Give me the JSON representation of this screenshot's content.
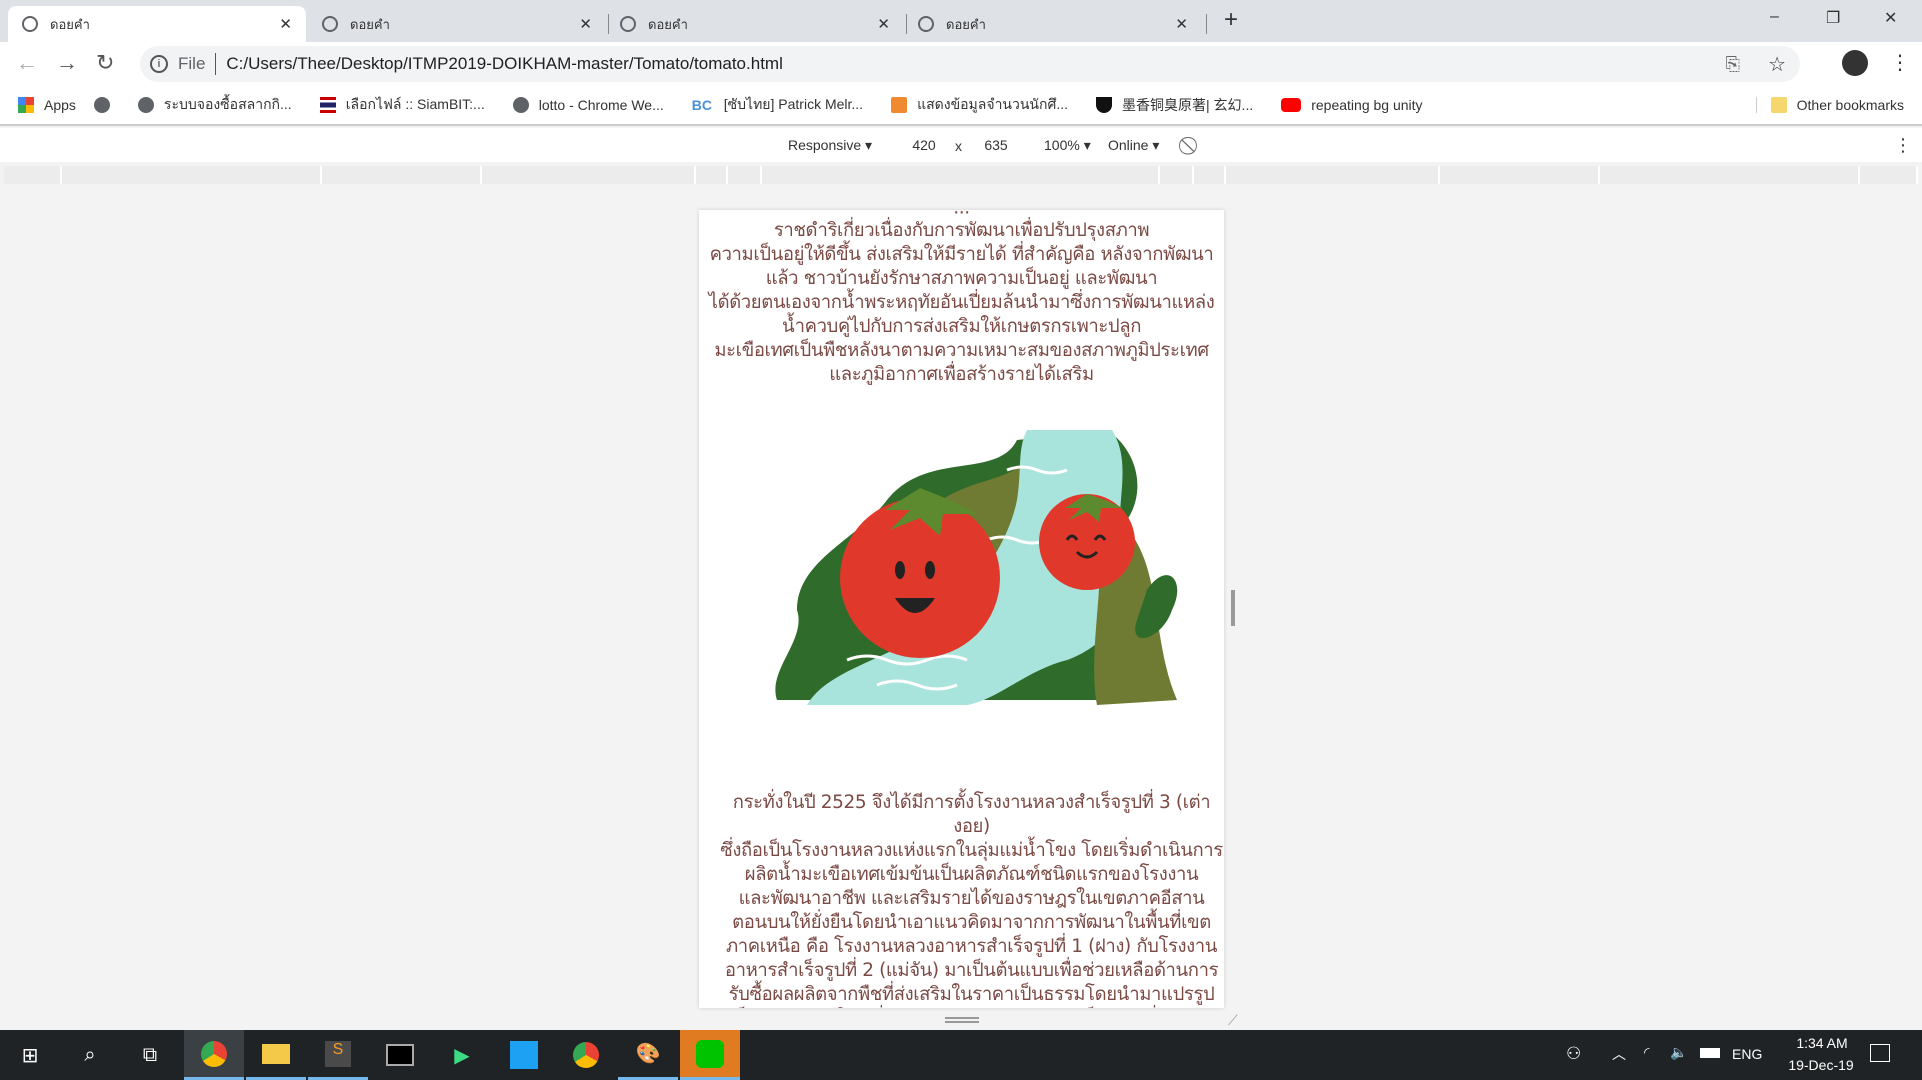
{
  "browser": {
    "tabs": [
      {
        "title": "ดอยคำ",
        "active": true
      },
      {
        "title": "ดอยคำ",
        "active": false
      },
      {
        "title": "ดอยคำ",
        "active": false
      },
      {
        "title": "ดอยคำ",
        "active": false
      }
    ],
    "new_tab_label": "+",
    "window_controls": {
      "minimize": "–",
      "restore": "❐",
      "close": "✕"
    },
    "address": {
      "scheme_label": "File",
      "url": "C:/Users/Thee/Desktop/ITMP2019-DOIKHAM-master/Tomato/tomato.html"
    },
    "bookmarks": [
      {
        "label": "Apps",
        "icon": "apps-grid-icon"
      },
      {
        "label": "",
        "icon": "globe-icon"
      },
      {
        "label": "ระบบจองซื้อสลากกิ...",
        "icon": "globe-icon"
      },
      {
        "label": "เลือกไฟล์ :: SiamBIT:...",
        "icon": "thai-flag-icon"
      },
      {
        "label": "lotto - Chrome We...",
        "icon": "globe-icon"
      },
      {
        "label": "[ซับไทย] Patrick Melr...",
        "icon": "bc-icon"
      },
      {
        "label": "แสดงข้อมูลจำนวนนักศึ...",
        "icon": "orange-app-icon"
      },
      {
        "label": "墨香铜臭原著| 玄幻...",
        "icon": "shield-icon"
      },
      {
        "label": "repeating bg unity",
        "icon": "youtube-icon"
      }
    ],
    "other_bookmarks": "Other bookmarks"
  },
  "devtools": {
    "device": "Responsive",
    "width": "420",
    "times": "x",
    "height": "635",
    "zoom": "100%",
    "throttle": "Online"
  },
  "page": {
    "paragraph1": [
      "ราชดำริเกี่ยวเนื่องกับการพัฒนาเพื่อปรับปรุงสภาพ",
      "ความเป็นอยู่ให้ดีขึ้น ส่งเสริมให้มีรายได้ ที่สำคัญคือ หลังจากพัฒนา",
      "แล้ว ชาวบ้านยังรักษาสภาพความเป็นอยู่ และพัฒนา",
      "ได้ด้วยตนเองจากน้ำพระหฤทัยอันเปี่ยมล้นนำมาซึ่งการพัฒนาแหล่ง",
      "น้ำควบคู่ไปกับการส่งเสริมให้เกษตรกรเพาะปลูก",
      "มะเขือเทศเป็นพืชหลังนาตามความเหมาะสมของสภาพภูมิประเทศ",
      "และภูมิอากาศเพื่อสร้างรายได้เสริม"
    ],
    "paragraph2": [
      "กระทั่งในปี 2525 จึงได้มีการตั้งโรงงานหลวงสำเร็จรูปที่ 3 (เต่างอย)",
      "ซึ่งถือเป็นโรงงานหลวงแห่งแรกในลุ่มแม่น้ำโขง โดยเริ่มดำเนินการ",
      "ผลิตน้ำมะเขือเทศเข้มข้นเป็นผลิตภัณฑ์ชนิดแรกของโรงงาน",
      "และพัฒนาอาชีพ และเสริมรายได้ของราษฎรในเขตภาคอีสาน",
      "ตอนบนให้ยั่งยืนโดยนำเอาแนวคิดมาจากการพัฒนาในพื้นที่เขต",
      "ภาคเหนือ คือ โรงงานหลวงอาหารสำเร็จรูปที่ 1 (ฝาง) กับโรงงาน",
      "อาหารสำเร็จรูปที่ 2 (แม่จัน) มาเป็นต้นแบบเพื่อช่วยเหลือด้านการ",
      "รับซื้อผลผลิตจากพืชที่ส่งเสริมในราคาเป็นธรรมโดยนำมาแปรรูป",
      "เป็นผลิตภัณฑ์ในเครื่องหมายการค้า“ดอยคำ” เป็นการเพิ่มมูลค่า"
    ]
  },
  "taskbar": {
    "lang": "ENG",
    "time": "1:34 AM",
    "date": "19-Dec-19"
  },
  "colors": {
    "text": "#7b4a45",
    "tomato": "#e0392b",
    "water": "#a9e4dc",
    "leaf_dark": "#2f6b2a",
    "leaf_olive": "#6f7a32"
  }
}
